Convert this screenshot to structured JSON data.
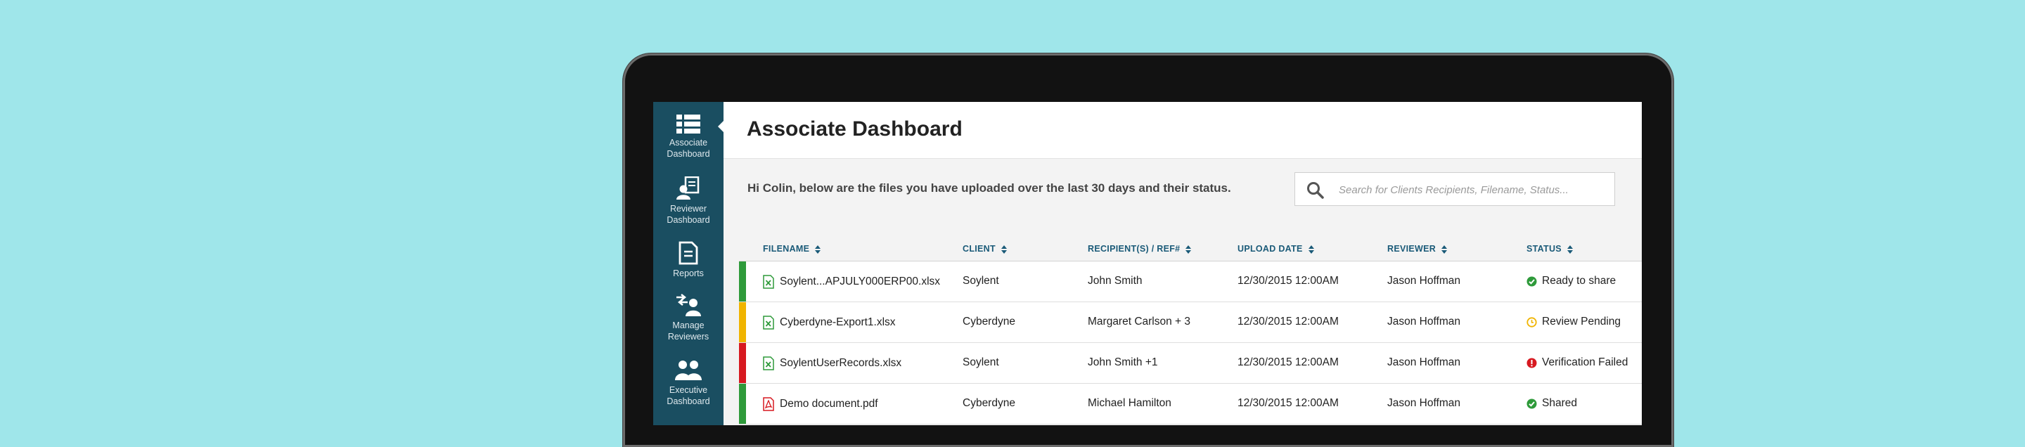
{
  "sidebar": {
    "items": [
      {
        "label": "Associate\nDashboard",
        "icon": "list-icon"
      },
      {
        "label": "Reviewer\nDashboard",
        "icon": "reviewer-icon"
      },
      {
        "label": "Reports",
        "icon": "report-icon"
      },
      {
        "label": "Manage\nReviewers",
        "icon": "manage-reviewers-icon"
      },
      {
        "label": "Executive\nDashboard",
        "icon": "executive-icon"
      }
    ],
    "bg_color": "#1a4e61"
  },
  "header": {
    "title": "Associate Dashboard"
  },
  "greeting": "Hi Colin, below are the files you have uploaded over the last 30 days and their status.",
  "search": {
    "placeholder": "Search for Clients Recipients, Filename, Status..."
  },
  "table": {
    "headers": {
      "filename": "FILENAME",
      "client": "CLIENT",
      "recipients": "RECIPIENT(S) / REF#",
      "upload_date": "UPLOAD DATE",
      "reviewer": "REVIEWER",
      "status": "STATUS"
    },
    "rows": [
      {
        "filename": "Soylent...APJULY000ERP00.xlsx",
        "file_type": "excel",
        "client": "Soylent",
        "recipients": "John Smith",
        "upload_date": "12/30/2015 12:00AM",
        "reviewer": "Jason Hoffman",
        "status": "Ready to share",
        "status_type": "success",
        "color": "#2e9a3a"
      },
      {
        "filename": "Cyberdyne-Export1.xlsx",
        "file_type": "excel",
        "client": "Cyberdyne",
        "recipients": "Margaret Carlson + 3",
        "upload_date": "12/30/2015 12:00AM",
        "reviewer": "Jason Hoffman",
        "status": "Review Pending",
        "status_type": "pending",
        "color": "#f0b400"
      },
      {
        "filename": "SoylentUserRecords.xlsx",
        "file_type": "excel",
        "client": "Soylent",
        "recipients": "John Smith +1",
        "upload_date": "12/30/2015 12:00AM",
        "reviewer": "Jason Hoffman",
        "status": "Verification Failed",
        "status_type": "error",
        "color": "#d71920"
      },
      {
        "filename": "Demo document.pdf",
        "file_type": "pdf",
        "client": "Cyberdyne",
        "recipients": "Michael Hamilton",
        "upload_date": "12/30/2015 12:00AM",
        "reviewer": "Jason Hoffman",
        "status": "Shared",
        "status_type": "success",
        "color": "#2e9a3a"
      }
    ]
  }
}
